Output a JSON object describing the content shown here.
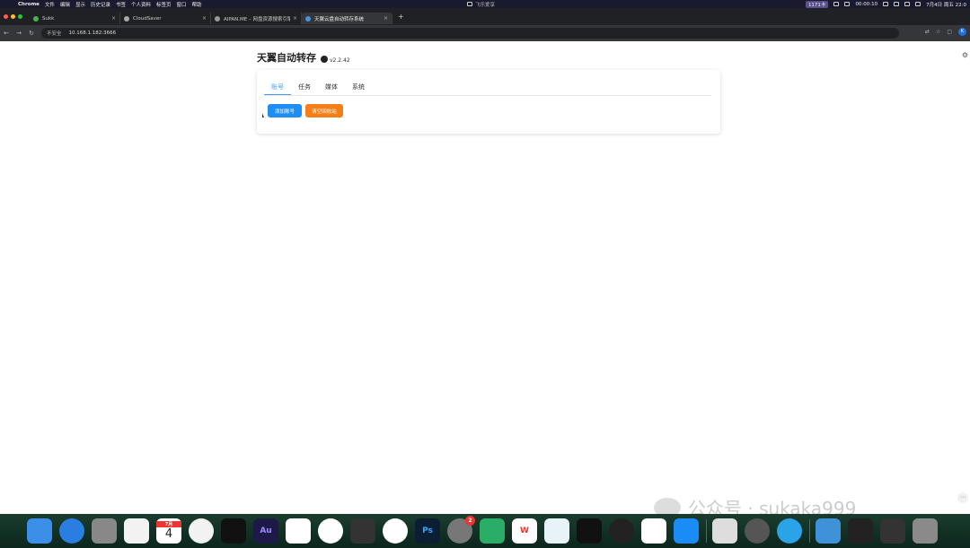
{
  "menubar": {
    "app": "Chrome",
    "items": [
      "文件",
      "编辑",
      "显示",
      "历史记录",
      "书签",
      "个人资料",
      "标签页",
      "窗口",
      "帮助"
    ],
    "center_label": "飞乐爱享",
    "status_pill": "1171卡",
    "timer": "00:00:10",
    "clock": "7月4日 周五 22:0"
  },
  "browser": {
    "tabs": [
      {
        "label": "Sukk",
        "active": false
      },
      {
        "label": "CloudSaver",
        "active": false
      },
      {
        "label": "AIPAN.ME – 网盘资源搜索引擎",
        "active": false
      },
      {
        "label": "天翼云盘自动转存系统",
        "active": true
      }
    ],
    "insecure_label": "不安全",
    "url": "10.168.1.182:3666",
    "avatar": "K"
  },
  "app": {
    "title": "天翼自动转存",
    "version": "v2.2.42",
    "nav": [
      "账号",
      "任务",
      "媒体",
      "系统"
    ],
    "active_nav": "账号",
    "buttons": {
      "add_account": "添加账号",
      "clear_recycle": "清空回收站"
    },
    "colors": {
      "primary": "#1e8ef7",
      "warning": "#f57e16",
      "tab_active": "#409eff"
    }
  },
  "watermark": "公众号 · sukaka999",
  "dock": {
    "calendar_month": "7月",
    "calendar_day": "4",
    "settings_badge": "2"
  }
}
